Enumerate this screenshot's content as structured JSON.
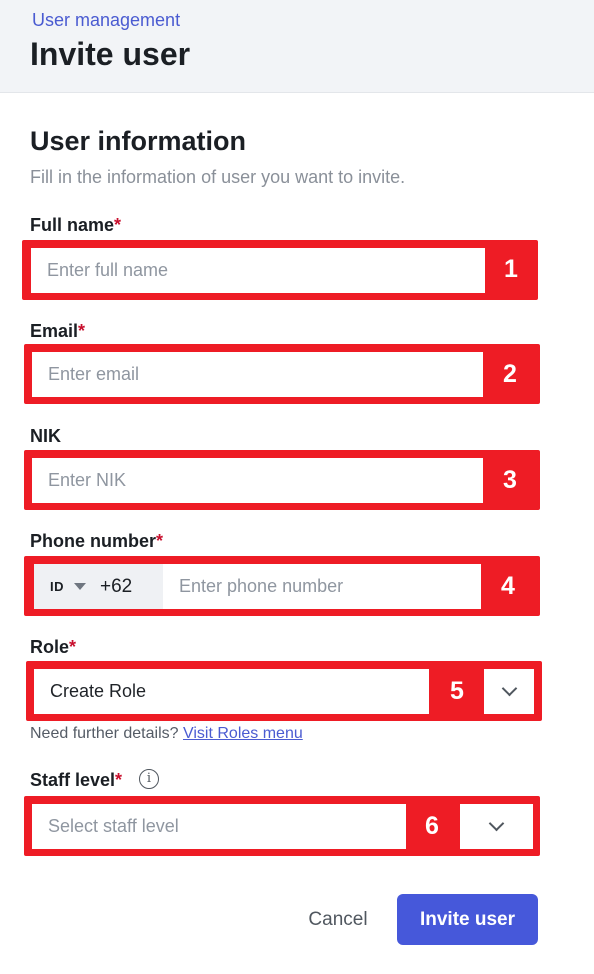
{
  "header": {
    "breadcrumb": "User management",
    "title": "Invite user"
  },
  "section": {
    "title": "User information",
    "subtitle": "Fill in the information of user you want to invite."
  },
  "fields": {
    "full_name": {
      "label": "Full name",
      "required_mark": "*",
      "placeholder": "Enter full name",
      "annotation": "1"
    },
    "email": {
      "label": "Email",
      "required_mark": "*",
      "placeholder": "Enter email",
      "annotation": "2"
    },
    "nik": {
      "label": "NIK",
      "placeholder": "Enter NIK",
      "annotation": "3"
    },
    "phone": {
      "label": "Phone number",
      "required_mark": "*",
      "country_code": "ID",
      "dial_code": "+62",
      "placeholder": "Enter phone number",
      "annotation": "4"
    },
    "role": {
      "label": "Role",
      "required_mark": "*",
      "value": "Create Role",
      "annotation": "5",
      "hint": "Need further details?",
      "hint_link": "Visit Roles menu"
    },
    "staff_level": {
      "label": "Staff level",
      "required_mark": "*",
      "placeholder": "Select staff level",
      "annotation": "6",
      "info_glyph": "i"
    }
  },
  "actions": {
    "cancel_label": "Cancel",
    "invite_label": "Invite user"
  },
  "colors": {
    "annotation": "#ee1c25",
    "primary": "#4658da",
    "link": "#4a5bd1",
    "required": "#c8102e"
  }
}
